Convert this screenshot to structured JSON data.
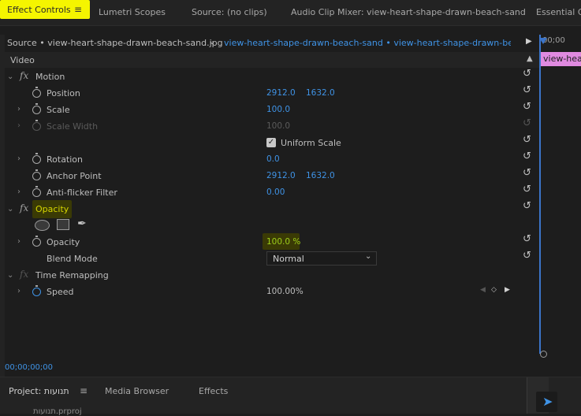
{
  "tabs": [
    "Effect Controls",
    "Lumetri Scopes",
    "Source: (no clips)",
    "Audio Clip Mixer: view-heart-shape-drawn-beach-sand",
    "Essential Gr"
  ],
  "source_bar": {
    "source": "Source • view-heart-shape-drawn-beach-sand.jpg",
    "sequence": "view-heart-shape-drawn-beach-sand • view-heart-shape-drawn-beach-s...",
    "timeline_time": "00;00",
    "clip_label": "view-hear"
  },
  "video_header": "Video",
  "motion": {
    "label": "Motion",
    "position": {
      "label": "Position",
      "x": "2912.0",
      "y": "1632.0"
    },
    "scale": {
      "label": "Scale",
      "value": "100.0"
    },
    "scale_width": {
      "label": "Scale Width",
      "value": "100.0"
    },
    "uniform_scale": "Uniform Scale",
    "rotation": {
      "label": "Rotation",
      "value": "0.0"
    },
    "anchor_point": {
      "label": "Anchor Point",
      "x": "2912.0",
      "y": "1632.0"
    },
    "anti_flicker": {
      "label": "Anti-flicker Filter",
      "value": "0.00"
    }
  },
  "opacity": {
    "label": "Opacity",
    "opacity": {
      "label": "Opacity",
      "value": "100.0 %"
    },
    "blend_mode": {
      "label": "Blend Mode",
      "value": "Normal"
    }
  },
  "time_remapping": {
    "label": "Time Remapping",
    "speed": {
      "label": "Speed",
      "value": "100.00%"
    }
  },
  "timecode": "00;00;00;00",
  "bottom_tabs": [
    "Project: תנועות",
    "Media Browser",
    "Effects"
  ],
  "bottom_partial": "תנועות.prproj",
  "colors": {
    "highlight": "#f5f500",
    "value_blue": "#3f93e6",
    "playhead": "#3b74c9",
    "clip_pink": "#e08ae0"
  }
}
